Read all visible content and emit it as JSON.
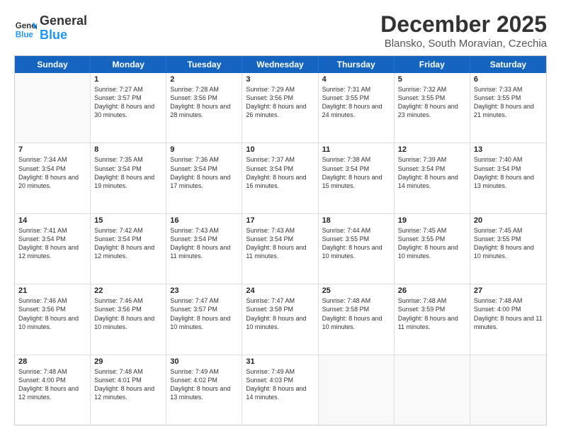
{
  "header": {
    "logo_general": "General",
    "logo_blue": "Blue",
    "month_title": "December 2025",
    "location": "Blansko, South Moravian, Czechia"
  },
  "days_of_week": [
    "Sunday",
    "Monday",
    "Tuesday",
    "Wednesday",
    "Thursday",
    "Friday",
    "Saturday"
  ],
  "weeks": [
    [
      {
        "day": "",
        "empty": true
      },
      {
        "day": "1",
        "sunrise": "Sunrise: 7:27 AM",
        "sunset": "Sunset: 3:57 PM",
        "daylight": "Daylight: 8 hours and 30 minutes."
      },
      {
        "day": "2",
        "sunrise": "Sunrise: 7:28 AM",
        "sunset": "Sunset: 3:56 PM",
        "daylight": "Daylight: 8 hours and 28 minutes."
      },
      {
        "day": "3",
        "sunrise": "Sunrise: 7:29 AM",
        "sunset": "Sunset: 3:56 PM",
        "daylight": "Daylight: 8 hours and 26 minutes."
      },
      {
        "day": "4",
        "sunrise": "Sunrise: 7:31 AM",
        "sunset": "Sunset: 3:55 PM",
        "daylight": "Daylight: 8 hours and 24 minutes."
      },
      {
        "day": "5",
        "sunrise": "Sunrise: 7:32 AM",
        "sunset": "Sunset: 3:55 PM",
        "daylight": "Daylight: 8 hours and 23 minutes."
      },
      {
        "day": "6",
        "sunrise": "Sunrise: 7:33 AM",
        "sunset": "Sunset: 3:55 PM",
        "daylight": "Daylight: 8 hours and 21 minutes."
      }
    ],
    [
      {
        "day": "7",
        "sunrise": "Sunrise: 7:34 AM",
        "sunset": "Sunset: 3:54 PM",
        "daylight": "Daylight: 8 hours and 20 minutes."
      },
      {
        "day": "8",
        "sunrise": "Sunrise: 7:35 AM",
        "sunset": "Sunset: 3:54 PM",
        "daylight": "Daylight: 8 hours and 19 minutes."
      },
      {
        "day": "9",
        "sunrise": "Sunrise: 7:36 AM",
        "sunset": "Sunset: 3:54 PM",
        "daylight": "Daylight: 8 hours and 17 minutes."
      },
      {
        "day": "10",
        "sunrise": "Sunrise: 7:37 AM",
        "sunset": "Sunset: 3:54 PM",
        "daylight": "Daylight: 8 hours and 16 minutes."
      },
      {
        "day": "11",
        "sunrise": "Sunrise: 7:38 AM",
        "sunset": "Sunset: 3:54 PM",
        "daylight": "Daylight: 8 hours and 15 minutes."
      },
      {
        "day": "12",
        "sunrise": "Sunrise: 7:39 AM",
        "sunset": "Sunset: 3:54 PM",
        "daylight": "Daylight: 8 hours and 14 minutes."
      },
      {
        "day": "13",
        "sunrise": "Sunrise: 7:40 AM",
        "sunset": "Sunset: 3:54 PM",
        "daylight": "Daylight: 8 hours and 13 minutes."
      }
    ],
    [
      {
        "day": "14",
        "sunrise": "Sunrise: 7:41 AM",
        "sunset": "Sunset: 3:54 PM",
        "daylight": "Daylight: 8 hours and 12 minutes."
      },
      {
        "day": "15",
        "sunrise": "Sunrise: 7:42 AM",
        "sunset": "Sunset: 3:54 PM",
        "daylight": "Daylight: 8 hours and 12 minutes."
      },
      {
        "day": "16",
        "sunrise": "Sunrise: 7:43 AM",
        "sunset": "Sunset: 3:54 PM",
        "daylight": "Daylight: 8 hours and 11 minutes."
      },
      {
        "day": "17",
        "sunrise": "Sunrise: 7:43 AM",
        "sunset": "Sunset: 3:54 PM",
        "daylight": "Daylight: 8 hours and 11 minutes."
      },
      {
        "day": "18",
        "sunrise": "Sunrise: 7:44 AM",
        "sunset": "Sunset: 3:55 PM",
        "daylight": "Daylight: 8 hours and 10 minutes."
      },
      {
        "day": "19",
        "sunrise": "Sunrise: 7:45 AM",
        "sunset": "Sunset: 3:55 PM",
        "daylight": "Daylight: 8 hours and 10 minutes."
      },
      {
        "day": "20",
        "sunrise": "Sunrise: 7:45 AM",
        "sunset": "Sunset: 3:55 PM",
        "daylight": "Daylight: 8 hours and 10 minutes."
      }
    ],
    [
      {
        "day": "21",
        "sunrise": "Sunrise: 7:46 AM",
        "sunset": "Sunset: 3:56 PM",
        "daylight": "Daylight: 8 hours and 10 minutes."
      },
      {
        "day": "22",
        "sunrise": "Sunrise: 7:46 AM",
        "sunset": "Sunset: 3:56 PM",
        "daylight": "Daylight: 8 hours and 10 minutes."
      },
      {
        "day": "23",
        "sunrise": "Sunrise: 7:47 AM",
        "sunset": "Sunset: 3:57 PM",
        "daylight": "Daylight: 8 hours and 10 minutes."
      },
      {
        "day": "24",
        "sunrise": "Sunrise: 7:47 AM",
        "sunset": "Sunset: 3:58 PM",
        "daylight": "Daylight: 8 hours and 10 minutes."
      },
      {
        "day": "25",
        "sunrise": "Sunrise: 7:48 AM",
        "sunset": "Sunset: 3:58 PM",
        "daylight": "Daylight: 8 hours and 10 minutes."
      },
      {
        "day": "26",
        "sunrise": "Sunrise: 7:48 AM",
        "sunset": "Sunset: 3:59 PM",
        "daylight": "Daylight: 8 hours and 11 minutes."
      },
      {
        "day": "27",
        "sunrise": "Sunrise: 7:48 AM",
        "sunset": "Sunset: 4:00 PM",
        "daylight": "Daylight: 8 hours and 11 minutes."
      }
    ],
    [
      {
        "day": "28",
        "sunrise": "Sunrise: 7:48 AM",
        "sunset": "Sunset: 4:00 PM",
        "daylight": "Daylight: 8 hours and 12 minutes."
      },
      {
        "day": "29",
        "sunrise": "Sunrise: 7:48 AM",
        "sunset": "Sunset: 4:01 PM",
        "daylight": "Daylight: 8 hours and 12 minutes."
      },
      {
        "day": "30",
        "sunrise": "Sunrise: 7:49 AM",
        "sunset": "Sunset: 4:02 PM",
        "daylight": "Daylight: 8 hours and 13 minutes."
      },
      {
        "day": "31",
        "sunrise": "Sunrise: 7:49 AM",
        "sunset": "Sunset: 4:03 PM",
        "daylight": "Daylight: 8 hours and 14 minutes."
      },
      {
        "day": "",
        "empty": true
      },
      {
        "day": "",
        "empty": true
      },
      {
        "day": "",
        "empty": true
      }
    ]
  ]
}
